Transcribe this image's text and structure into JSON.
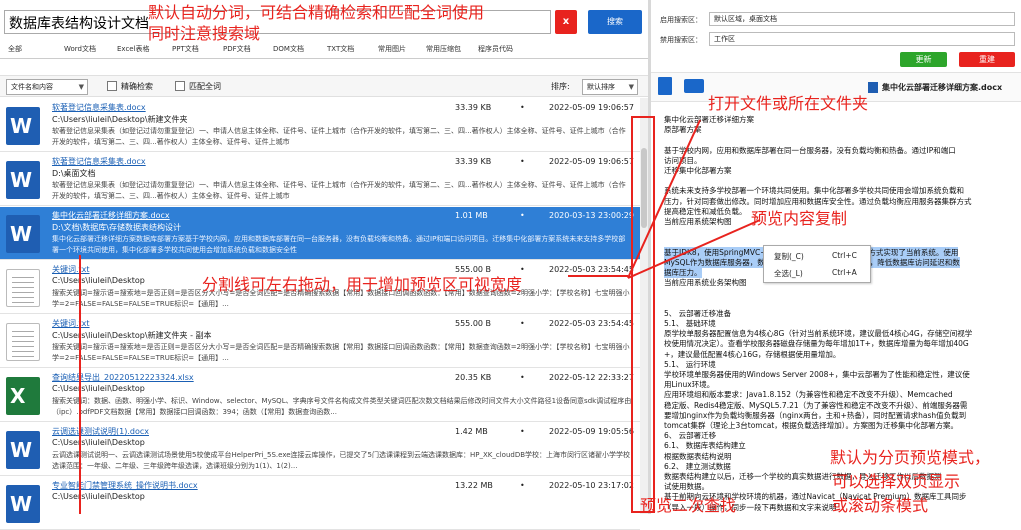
{
  "search": {
    "value": "数据库表结构设计文档",
    "clear_label": "x",
    "button_label": "搜索"
  },
  "tabs": [
    "全部",
    "Word文档",
    "Excel表格",
    "PPT文档",
    "PDF文档",
    "DOM文档",
    "TXT文档",
    "常用图片",
    "常用压缩包",
    "程序员代码"
  ],
  "filter": {
    "scope": "文件名和内容",
    "precise": "精确检索",
    "full_match": "匹配全词",
    "sort_label": "排序:",
    "sort_value": "默认排序"
  },
  "results": [
    {
      "name": "软著登记信息采集表.docx",
      "path": "C:\\Users\\liuleil\\Desktop\\新建文件夹",
      "size": "33.39 KB",
      "date": "2022-05-09 19:06:57",
      "type": "doc",
      "snippet": "软著登记信息采集表（如登记过请勿重复登记）一、申请人信息主体全称、证件号、证件上城市（合作开发的软件，填写第二、三、四...著作权人）主体全称、证件号、证件上城市（合作开发的软件，填写第二、三、四...著作权人）主体全称、证件号、证件上城市"
    },
    {
      "name": "软著登记信息采集表.docx",
      "path": "D:\\桌面文档",
      "size": "33.39 KB",
      "date": "2022-05-09 19:06:57",
      "type": "doc",
      "snippet": "软著登记信息采集表（如登记过请勿重复登记）一、申请人信息主体全称、证件号、证件上城市（合作开发的软件，填写第二、三、四...著作权人）主体全称、证件号、证件上城市（合作开发的软件，填写第二、三、四...著作权人）主体全称、证件号、证件上城市"
    },
    {
      "name": "集中化云部署迁移详细方案.docx",
      "path": "D:\\文档\\数据库\\存储数据表结构设计",
      "size": "1.01 MB",
      "date": "2020-03-13 23:00:29",
      "type": "doc",
      "snippet": "集中化云部署迁移详细方案数据库部署方案基于学校内网，应用和数据库部署在同一台服务器，没有负载均衡和热备。通过IP和端口访问项目。迁移集中化部署方案系统未来支持多学校部署一个环境共同使用，集中化部署多学校共同使用会增加系统负载和数据安全性"
    },
    {
      "name": "关键词.txt",
      "path": "C:\\Users\\liuleil\\Desktop",
      "size": "555.00 B",
      "date": "2022-05-03 23:54:45",
      "type": "txt",
      "snippet": "搜索关键词=搜示语=搜索地=是否正则=是否区分大小写=是否全词匹配=是否精确搜索数据【常用】数据接口回调函数函数：【常用】数据查询函数=2明强小学：【学校名称】七宝明强小学=2=FALSE=FALSE=FALSE=TRUE标识=【通用】..."
    },
    {
      "name": "关键词.txt",
      "path": "C:\\Users\\liuleil\\Desktop\\新建文件夹 - 副本",
      "size": "555.00 B",
      "date": "2022-05-03 23:54:45",
      "type": "txt",
      "snippet": "搜索关键词=搜示语=搜索地=是否正则=是否区分大小写=是否全词匹配=是否精确搜索数据【常用】数据接口回调函数函数：【常用】数据查询函数=2明强小学：【学校名称】七宝明强小学=2=FALSE=FALSE=FALSE=TRUE标识=【通用】..."
    },
    {
      "name": "查询结果导出_20220512223324.xlsx",
      "path": "C:\\Users\\liuleil\\Desktop",
      "size": "20.35 KB",
      "date": "2022-05-12 22:33:27",
      "type": "xls",
      "snippet": "搜索关键词：数据、函数、明强小学、标识、Window、selector、MySQL、字典序号文件名构成文件类型关键词匹配次数文档结果后修改时间文件大小文件路径1设备同意sdk调试程序由（ipc）.pdfPDF文档数据【常用】数据接口回调函数：394；函数（【常用】数据查询函数..."
    },
    {
      "name": "云调选课测试说明(1).docx",
      "path": "C:\\Users\\liuleil\\Desktop",
      "size": "1.42 MB",
      "date": "2022-05-09 19:05:56",
      "type": "doc",
      "snippet": "云调选课测试说明一、云调选课测试场景使用5校使成平台HelperPri_5S.exe连接云库操作，已提交了5门选课课程到云端选课数据库：HP_XK_cloudDB学校：上海市闵行区诸翟小学学校选课范围：一年级、二年级、三年级跨年级选课，选课班级分别为1(1)、1(2)..."
    },
    {
      "name": "专业智能门禁管理系统_操作说明书.docx",
      "path": "C:\\Users\\liuleil\\Desktop",
      "size": "13.22 MB",
      "date": "2022-05-10 23:17:02",
      "type": "doc",
      "snippet": ""
    }
  ],
  "right": {
    "enable_label": "启用搜索区：",
    "enable_value": "默认区域，桌面文档",
    "disable_label": "禁用搜索区：",
    "disable_value": "工作区",
    "update_btn": "更新",
    "reset_btn": "重建",
    "preview_title": "集中化云部署迁移详细方案.docx",
    "preview_lines": [
      "集中化云部署迁移详细方案",
      "原部署方案",
      "",
      "基于学校内网，应用和数据库部署在同一台服务器，没有负载均衡和热备。通过IP和端口",
      "访问项目。",
      "迁移集中化部署方案",
      "",
      "系统未来支持多学校部署一个环境共同使用。集中化部署多学校共同使用会增加系统负载和",
      "压力，针对同套做出修改。同时增加应用和数据库安全性。通过负载均衡应用服务器集群方式",
      "提高稳定性和减低负载。",
      "当前应用系统架构图",
      "",
      "",
      "基于JDK8，使用SpringMVC+Hibernate技术架构开发B/S的方式实现了当前系统。使用",
      "MySQL作为数据库服务器，数据量并不大，但存储服务器资源，降低数据库访问延迟和数",
      "据库压力。",
      "当前应用系统业务架构图",
      "",
      "",
      "5、  云部署迁移准备",
      "5.1、  基础环境",
      "原学校单服务器配置信息为4核心8G（针对当前系统环境，建议最低4核心4G，存储空间视学",
      "校使用情况决定）。查看学校服务器磁盘存储量为每年增加1T+，数据库增量为每年增加40G",
      "+，建议最低配置4核心16G，存储根据使用量增加。",
      "5.1、  运行环境",
      "学校环境单服务器使用的Windows  Server  2008+，集中云部署为了性能和稳定性，建议使",
      "用Linux环境。",
      "应用环境组和版本要求：Java1.8.152（为兼容性和稳定不改变不升级）、Memcached",
      "稳定版、Redis4稳定版、MySQL5.7.21（为了兼容性和稳定不改变不升级）、前端服务器需",
      "要增加nginx作为负载均衡服务器（nginx两台，主和+热备），同时配置请求hash值负载到",
      "tomcat集群（理论上3台tomcat，根据负载选择增加）。方案图为迁移集中化部署方案。",
      "6、  云部署迁移",
      "6.1、  数据库表结构建立",
      "根据数据表结构说明",
      "6.2、  建立测试数据",
      "数据表结构建立以后，迁移一个学校的真实数据进行数据，导入迁移工作以后数据测",
      "试使用数据。",
      "基于前期向云环境和学校环境的机器，通过Navicat（Navicat Premium）数据库工具同步",
      "（导入一段）操作，同步一段下再数据和文字来说明"
    ],
    "ctx_copy": "复制(_C)",
    "ctx_copy_key": "Ctrl+C",
    "ctx_all": "全选(_L)",
    "ctx_all_key": "Ctrl+A"
  },
  "annotations": {
    "a1": "默认自动分词，可结合精确检索和匹配全词使用",
    "a2": "同时注意搜索域",
    "a3": "打开文件或所在文件夹",
    "a4": "预览内容复制",
    "a5": "分割线可左右拖动，用于增加预览区可视宽度",
    "a6": "默认为分页预览模式，",
    "a7": "可以选择双页显示",
    "a8": "或滚动条模式",
    "a9": "预览二次查找"
  },
  "colors": {
    "accent": "#1a67c9",
    "selected_row": "#2f7fd6",
    "danger": "#e8231e",
    "green": "#2da52b",
    "annotation": "#e8231e"
  }
}
